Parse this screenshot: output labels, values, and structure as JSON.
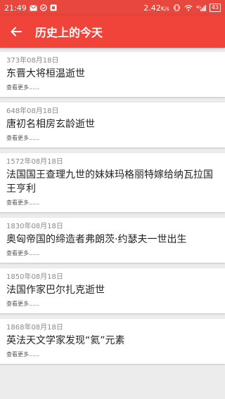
{
  "status_bar": {
    "time": "21:49",
    "speed": "2.42",
    "speed_unit": "K/s",
    "signal_text": "4G",
    "battery": "43"
  },
  "header": {
    "title": "历史上的今天",
    "back_icon": "arrow-left-icon"
  },
  "events": [
    {
      "date": "373年08月18日",
      "title": "东晋大将桓温逝世",
      "more": "查看更多......"
    },
    {
      "date": "648年08月18日",
      "title": "唐初名相房玄龄逝世",
      "more": "查看更多......"
    },
    {
      "date": "1572年08月18日",
      "title": "法国国王查理九世的妹妹玛格丽特嫁给纳瓦拉国王亨利",
      "more": "查看更多......"
    },
    {
      "date": "1830年08月18日",
      "title": "奥匈帝国的缔造者弗朗茨·约瑟夫一世出生",
      "more": "查看更多......"
    },
    {
      "date": "1850年08月18日",
      "title": "法国作家巴尔扎克逝世",
      "more": "查看更多......"
    },
    {
      "date": "1868年08月18日",
      "title": "英法天文学家发现“氦”元素",
      "more": "查看更多......"
    }
  ],
  "colors": {
    "accent": "#f0433a",
    "status_bar": "#e8473d",
    "background": "#ececec"
  }
}
